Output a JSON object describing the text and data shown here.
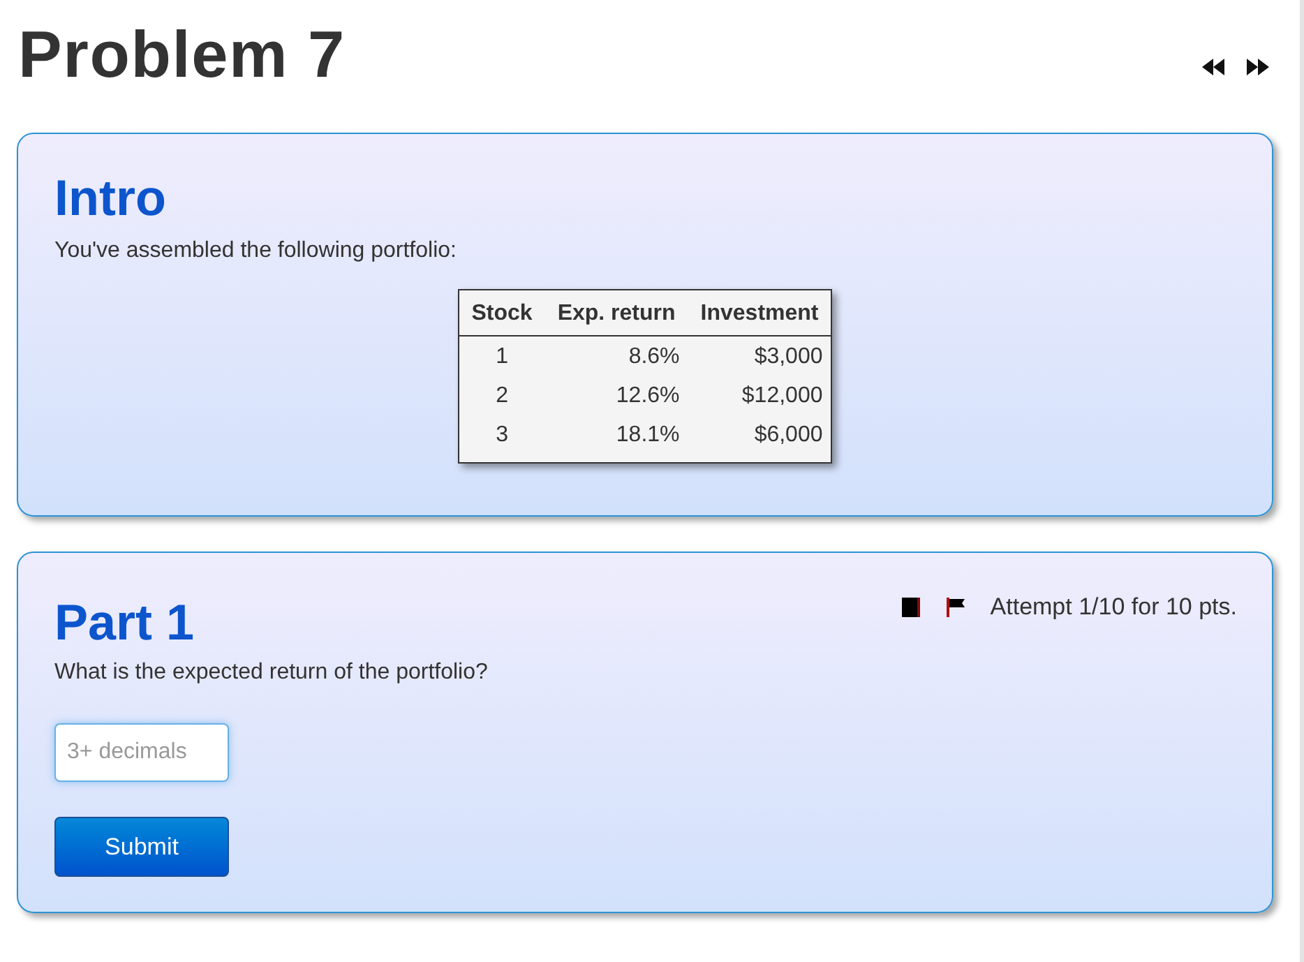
{
  "page": {
    "title": "Problem 7"
  },
  "intro": {
    "heading": "Intro",
    "text": "You've assembled the following portfolio:",
    "table": {
      "columns": [
        "Stock",
        "Exp. return",
        "Investment"
      ],
      "rows": [
        [
          "1",
          "8.6%",
          "$3,000"
        ],
        [
          "2",
          "12.6%",
          "$12,000"
        ],
        [
          "3",
          "18.1%",
          "$6,000"
        ]
      ]
    }
  },
  "part": {
    "heading": "Part 1",
    "attempt": "Attempt 1/10 for 10 pts.",
    "question": "What is the expected return of the portfolio?",
    "answer_field": {
      "placeholder": "3+ decimals",
      "focused": true
    },
    "submit": "Submit"
  }
}
